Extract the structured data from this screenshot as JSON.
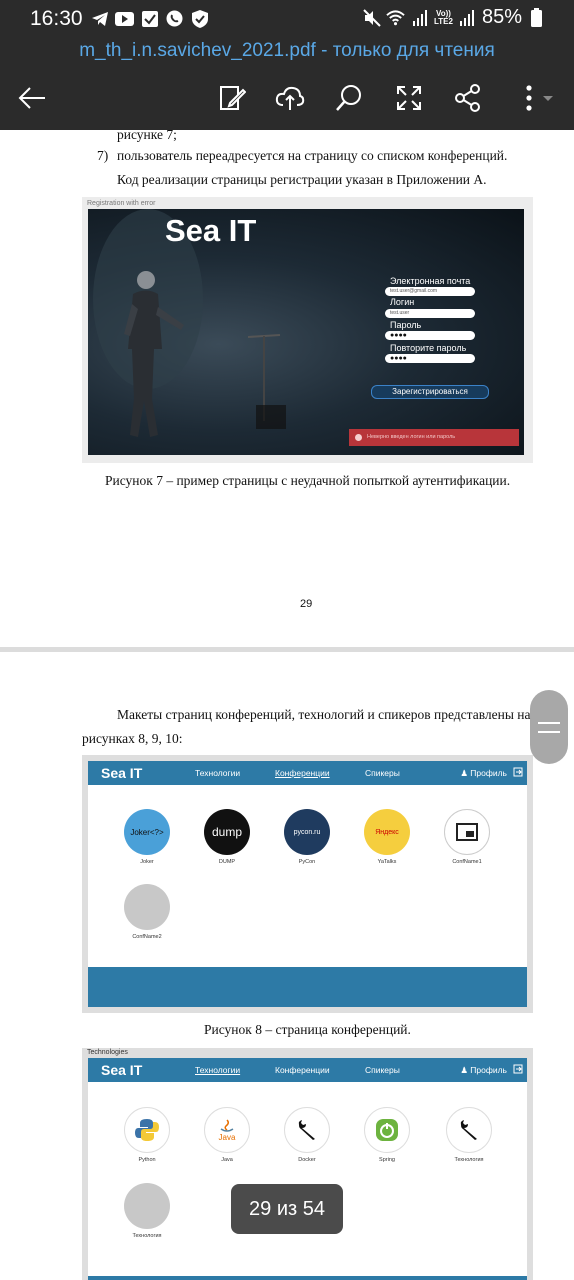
{
  "status_bar": {
    "time": "16:30",
    "volte": "Vo))",
    "lte": "LTE2",
    "battery": "85%"
  },
  "titlebar": {
    "title": "m_th_i.n.savichev_2021.pdf - только для чтения"
  },
  "toolbar": {
    "icons": [
      "back-icon",
      "edit-icon",
      "cloud-upload-icon",
      "search-icon",
      "fullscreen-icon",
      "share-icon",
      "more-icon"
    ]
  },
  "page1": {
    "line_top": "рисунке 7;",
    "list_item_num": "7)",
    "list_item_text": "пользователь переадресуется на страницу со списком конференций.",
    "paragraph": "Код реализации страницы регистрации указан в Приложении А.",
    "figure": {
      "tag": "Registration with error",
      "brand": "Sea IT",
      "email_label": "Электронная почта",
      "email_value": "test.user@gmail.com",
      "login_label": "Логин",
      "login_value": "test.user",
      "password_label": "Пароль",
      "password_value": "●●●●",
      "repeat_label": "Повторите пароль",
      "repeat_value": "●●●●",
      "submit": "Зарегистрироваться",
      "error": "Неверно введен логин или пароль"
    },
    "caption": "Рисунок 7 – пример страницы с неудачной попыткой аутентификации.",
    "page_number": "29"
  },
  "page2": {
    "paragraph_line1": "Макеты страниц конференций, технологий и спикеров представлены на",
    "paragraph_line2": "рисунках 8, 9, 10:",
    "figure8": {
      "brand": "Sea IT",
      "nav": [
        "Технологии",
        "Конференции",
        "Спикеры"
      ],
      "profile": "Профиль",
      "tiles": [
        {
          "name": "Joker",
          "logo": "Joker<?>",
          "color": "#4aa0d8"
        },
        {
          "name": "DUMP",
          "logo": "dump",
          "color": "#111111"
        },
        {
          "name": "PyCon",
          "logo": "pycon.ru",
          "color": "#1f3b5f"
        },
        {
          "name": "YaTalks",
          "logo": "Яндекс",
          "color": "#f5ce3e"
        },
        {
          "name": "ConfName1",
          "logo": "",
          "color": "#ffffff"
        },
        {
          "name": "ConfName2",
          "logo": "",
          "color": "#c8c8c8"
        }
      ]
    },
    "caption8": "Рисунок 8 – страница конференций.",
    "figure9": {
      "tag": "Technologies",
      "brand": "Sea IT",
      "nav": [
        "Технологии",
        "Конференции",
        "Спикеры"
      ],
      "profile": "Профиль",
      "tiles": [
        {
          "name": "Python",
          "icon": "python-icon"
        },
        {
          "name": "Java",
          "icon": "java-icon"
        },
        {
          "name": "Docker",
          "icon": "wrench-icon"
        },
        {
          "name": "Spring",
          "icon": "spring-icon"
        },
        {
          "name": "Технология",
          "icon": "wrench-icon"
        },
        {
          "name": "Технология",
          "icon": ""
        }
      ]
    }
  },
  "page_indicator": "29 из 54"
}
